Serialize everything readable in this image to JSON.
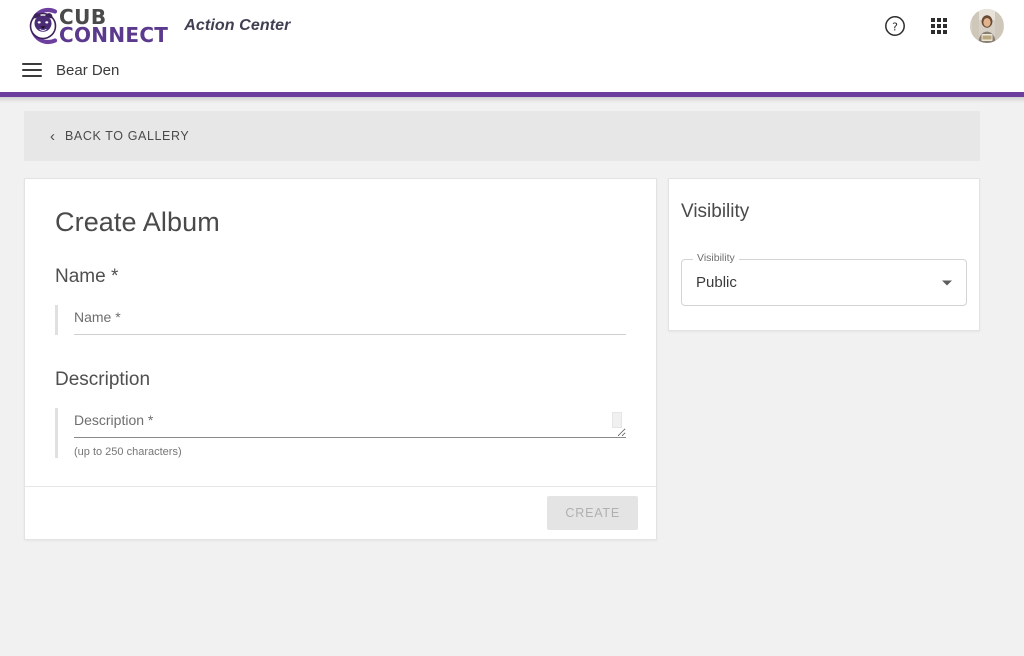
{
  "header": {
    "logo": {
      "icon": "bear-head-logo-icon",
      "line1": "CUB",
      "line2": "CONNECT"
    },
    "subtitle": "Action Center",
    "help_icon": "help-circle-icon",
    "apps_icon": "apps-grid-icon",
    "avatar_icon": "user-avatar",
    "menu_icon": "hamburger-menu-icon",
    "org_name": "Bear Den",
    "accent_color": "#6c3f9e"
  },
  "back_bar": {
    "chevron": "‹",
    "label": "BACK TO GALLERY"
  },
  "create_album": {
    "title": "Create Album",
    "name": {
      "label": "Name *",
      "placeholder": "Name *",
      "value": ""
    },
    "description": {
      "label": "Description",
      "placeholder": "Description *",
      "value": "",
      "hint": "(up to 250 characters)"
    },
    "submit_label": "CREATE",
    "submit_disabled": true
  },
  "visibility": {
    "panel_title": "Visibility",
    "select_legend": "Visibility",
    "selected_value": "Public"
  }
}
